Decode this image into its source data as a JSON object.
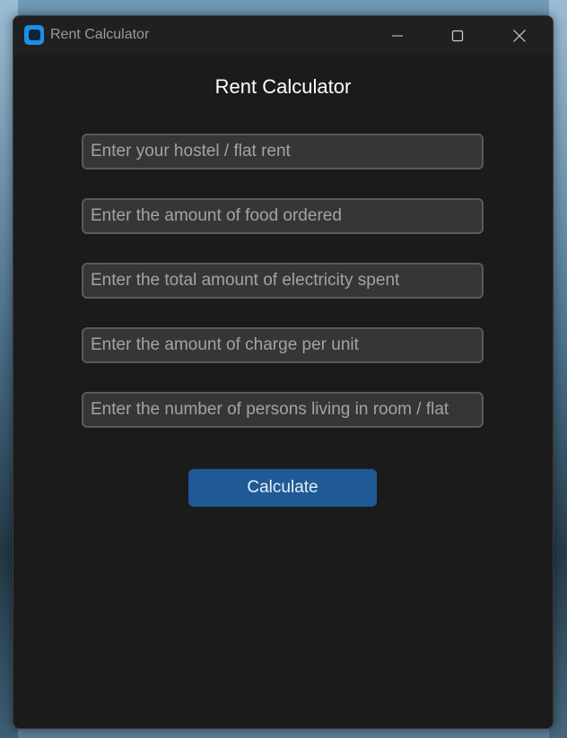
{
  "window": {
    "title": "Rent Calculator"
  },
  "app": {
    "heading": "Rent Calculator"
  },
  "fields": [
    {
      "placeholder": "Enter your hostel / flat rent",
      "value": ""
    },
    {
      "placeholder": "Enter the amount of food ordered",
      "value": ""
    },
    {
      "placeholder": "Enter the total amount of electricity spent",
      "value": ""
    },
    {
      "placeholder": "Enter the amount of charge per unit",
      "value": ""
    },
    {
      "placeholder": "Enter the number of persons living in room / flat",
      "value": ""
    }
  ],
  "actions": {
    "calculate_label": "Calculate"
  },
  "icons": {
    "app": "app-icon",
    "minimize": "minimize-icon",
    "maximize": "maximize-icon",
    "close": "close-icon"
  },
  "colors": {
    "window_bg": "#1b1b1b",
    "titlebar_bg": "#202020",
    "field_bg": "#343638",
    "field_border": "#565b5e",
    "button_bg": "#1f5a96",
    "app_icon": "#1c8fe6"
  }
}
